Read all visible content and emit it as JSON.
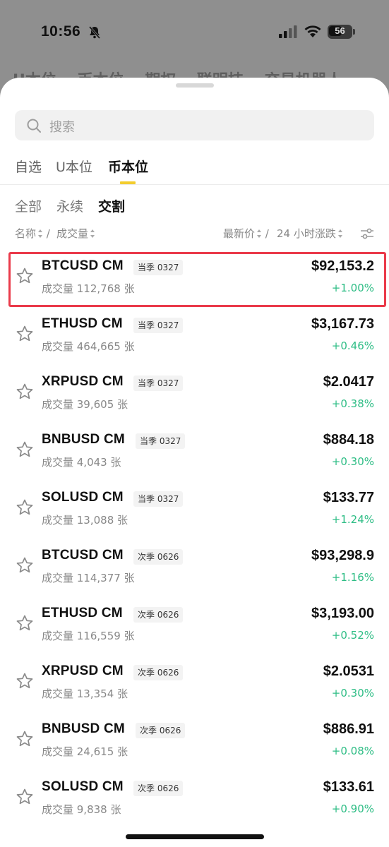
{
  "status_bar": {
    "time": "10:56",
    "battery": "56"
  },
  "background_tabs": [
    "U本位",
    "币本位",
    "期权",
    "联明技",
    "交易机器人"
  ],
  "search": {
    "placeholder": "搜索"
  },
  "main_tabs": [
    {
      "label": "自选",
      "active": false
    },
    {
      "label": "U本位",
      "active": false
    },
    {
      "label": "币本位",
      "active": true
    }
  ],
  "sub_tabs": [
    {
      "label": "全部",
      "active": false
    },
    {
      "label": "永续",
      "active": false
    },
    {
      "label": "交割",
      "active": true
    }
  ],
  "columns": {
    "name": "名称",
    "separator1": "/",
    "volume": "成交量",
    "last_price": "最新价",
    "separator2": "/",
    "change_24h": "24 小时涨跌"
  },
  "rows": [
    {
      "symbol": "BTCUSD CM",
      "badge": "当季 0327",
      "volume": "成交量 112,768 张",
      "price": "$92,153.2",
      "change": "+1.00%"
    },
    {
      "symbol": "ETHUSD CM",
      "badge": "当季 0327",
      "volume": "成交量 464,665 张",
      "price": "$3,167.73",
      "change": "+0.46%"
    },
    {
      "symbol": "XRPUSD CM",
      "badge": "当季 0327",
      "volume": "成交量 39,605 张",
      "price": "$2.0417",
      "change": "+0.38%"
    },
    {
      "symbol": "BNBUSD CM",
      "badge": "当季 0327",
      "volume": "成交量 4,043 张",
      "price": "$884.18",
      "change": "+0.30%"
    },
    {
      "symbol": "SOLUSD CM",
      "badge": "当季 0327",
      "volume": "成交量 13,088 张",
      "price": "$133.77",
      "change": "+1.24%"
    },
    {
      "symbol": "BTCUSD CM",
      "badge": "次季 0626",
      "volume": "成交量 114,377 张",
      "price": "$93,298.9",
      "change": "+1.16%"
    },
    {
      "symbol": "ETHUSD CM",
      "badge": "次季 0626",
      "volume": "成交量 116,559 张",
      "price": "$3,193.00",
      "change": "+0.52%"
    },
    {
      "symbol": "XRPUSD CM",
      "badge": "次季 0626",
      "volume": "成交量 13,354 张",
      "price": "$2.0531",
      "change": "+0.30%"
    },
    {
      "symbol": "BNBUSD CM",
      "badge": "次季 0626",
      "volume": "成交量 24,615 张",
      "price": "$886.91",
      "change": "+0.08%"
    },
    {
      "symbol": "SOLUSD CM",
      "badge": "次季 0626",
      "volume": "成交量 9,838 张",
      "price": "$133.61",
      "change": "+0.90%"
    }
  ],
  "colors": {
    "accent_underline": "#f3cd2e",
    "positive_change": "#2ebd85",
    "highlight_box": "#ea3a4a"
  },
  "icons": {
    "search": "search-icon",
    "star": "star-icon",
    "sort": "sort-icon",
    "filter": "filter-settings-icon",
    "bell_muted": "bell-slash-icon",
    "signal": "cellular-signal-icon",
    "wifi": "wifi-icon",
    "battery": "battery-icon"
  }
}
